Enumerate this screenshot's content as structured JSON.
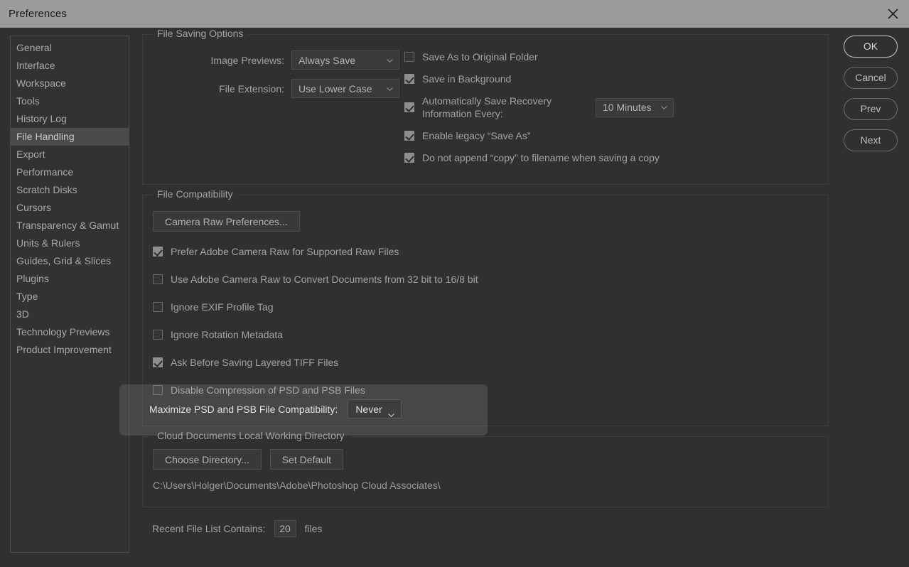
{
  "window": {
    "title": "Preferences",
    "close_icon": "close-icon"
  },
  "sidebar": {
    "items": [
      {
        "label": "General",
        "selected": false
      },
      {
        "label": "Interface",
        "selected": false
      },
      {
        "label": "Workspace",
        "selected": false
      },
      {
        "label": "Tools",
        "selected": false
      },
      {
        "label": "History Log",
        "selected": false
      },
      {
        "label": "File Handling",
        "selected": true
      },
      {
        "label": "Export",
        "selected": false
      },
      {
        "label": "Performance",
        "selected": false
      },
      {
        "label": "Scratch Disks",
        "selected": false
      },
      {
        "label": "Cursors",
        "selected": false
      },
      {
        "label": "Transparency & Gamut",
        "selected": false
      },
      {
        "label": "Units & Rulers",
        "selected": false
      },
      {
        "label": "Guides, Grid & Slices",
        "selected": false
      },
      {
        "label": "Plugins",
        "selected": false
      },
      {
        "label": "Type",
        "selected": false
      },
      {
        "label": "3D",
        "selected": false
      },
      {
        "label": "Technology Previews",
        "selected": false
      },
      {
        "label": "Product Improvement",
        "selected": false
      }
    ]
  },
  "buttons": {
    "ok": "OK",
    "cancel": "Cancel",
    "prev": "Prev",
    "next": "Next"
  },
  "file_saving_options": {
    "legend": "File Saving Options",
    "image_previews_label": "Image Previews:",
    "image_previews_value": "Always Save",
    "file_extension_label": "File Extension:",
    "file_extension_value": "Use Lower Case",
    "checkboxes": [
      {
        "label": "Save As to Original Folder",
        "checked": false
      },
      {
        "label": "Save in Background",
        "checked": true
      },
      {
        "label": "Automatically Save Recovery Information Every:",
        "checked": true
      },
      {
        "label": "Enable legacy “Save As”",
        "checked": true
      },
      {
        "label": "Do not append “copy” to filename when saving a copy",
        "checked": true
      }
    ],
    "recovery_interval_value": "10 Minutes"
  },
  "file_compatibility": {
    "legend": "File Compatibility",
    "camera_raw_button": "Camera Raw Preferences...",
    "checkboxes": [
      {
        "label": "Prefer Adobe Camera Raw for Supported Raw Files",
        "checked": true
      },
      {
        "label": "Use Adobe Camera Raw to Convert Documents from 32 bit to 16/8 bit",
        "checked": false
      },
      {
        "label": "Ignore EXIF Profile Tag",
        "checked": false
      },
      {
        "label": "Ignore Rotation Metadata",
        "checked": false
      },
      {
        "label": "Ask Before Saving Layered TIFF Files",
        "checked": true
      },
      {
        "label": "Disable Compression of PSD and PSB Files",
        "checked": false
      }
    ],
    "maximize_label": "Maximize PSD and PSB File Compatibility:",
    "maximize_value": "Never"
  },
  "cloud_documents": {
    "legend": "Cloud Documents Local Working Directory",
    "choose_directory_button": "Choose Directory...",
    "set_default_button": "Set Default",
    "path": "C:\\Users\\Holger\\Documents\\Adobe\\Photoshop Cloud Associates\\"
  },
  "recent_files": {
    "label": "Recent File List Contains:",
    "value": "20",
    "suffix": "files"
  },
  "colors": {
    "titlebar": "#9b9b9b",
    "background": "#303030",
    "selected_item": "#4b4b4b",
    "text": "#a3a3a3"
  }
}
